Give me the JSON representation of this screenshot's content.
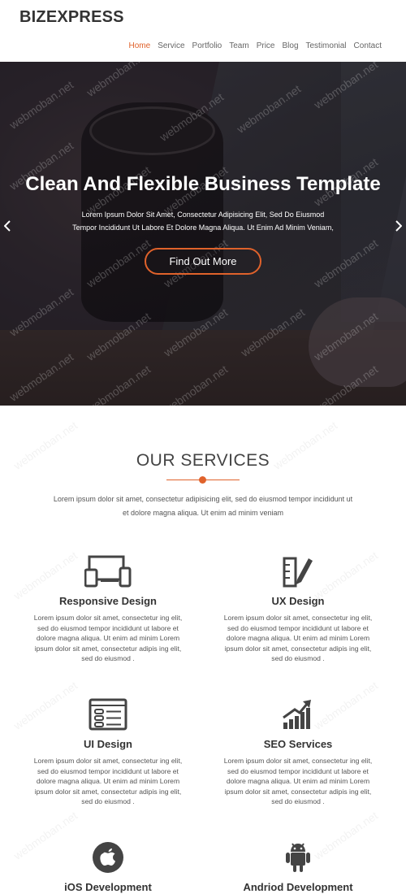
{
  "header": {
    "logo": "BIZEXPRESS",
    "nav": [
      "Home",
      "Service",
      "Portfolio",
      "Team",
      "Price",
      "Blog",
      "Testimonial",
      "Contact"
    ],
    "active_index": 0,
    "accent_color": "#e0622b"
  },
  "hero": {
    "title": "Clean And Flexible Business Template",
    "text_line1": "Lorem Ipsum Dolor Sit Amet, Consectetur Adipisicing Elit, Sed Do Eiusmod",
    "text_line2": "Tempor Incididunt Ut Labore Et Dolore Magna Aliqua. Ut Enim Ad Minim Veniam,",
    "button": "Find Out More",
    "prev_icon": "chevron-left-icon",
    "next_icon": "chevron-right-icon"
  },
  "watermark": "webmoban.net",
  "services": {
    "title": "OUR SERVICES",
    "intro_line1": "Lorem ipsum dolor sit amet, consectetur adipisicing elit, sed do eiusmod tempor incididunt ut",
    "intro_line2": "et dolore magna aliqua. Ut enim ad minim veniam",
    "items": [
      {
        "title": "Responsive Design",
        "icon": "devices-icon",
        "lines": [
          "Lorem ipsum dolor sit amet, consectetur ing elit,",
          "sed do eiusmod tempor incididunt ut labore et",
          "dolore magna aliqua. Ut enim ad minim Lorem",
          "ipsum dolor sit amet, consectetur adipis ing elit,",
          "sed do eiusmod ."
        ]
      },
      {
        "title": "UX Design",
        "icon": "pencil-ruler-icon",
        "lines": [
          "Lorem ipsum dolor sit amet, consectetur ing elit,",
          "sed do eiusmod tempor incididunt ut labore et",
          "dolore magna aliqua. Ut enim ad minim Lorem",
          "ipsum dolor sit amet, consectetur adipis ing elit,",
          "sed do eiusmod ."
        ]
      },
      {
        "title": "UI Design",
        "icon": "sliders-window-icon",
        "lines": [
          "Lorem ipsum dolor sit amet, consectetur ing elit,",
          "sed do eiusmod tempor incididunt ut labore et",
          "dolore magna aliqua. Ut enim ad minim Lorem",
          "ipsum dolor sit amet, consectetur adipis ing elit,",
          "sed do eiusmod ."
        ]
      },
      {
        "title": "SEO Services",
        "icon": "growth-chart-icon",
        "lines": [
          "Lorem ipsum dolor sit amet, consectetur ing elit,",
          "sed do eiusmod tempor incididunt ut labore et",
          "dolore magna aliqua. Ut enim ad minim Lorem",
          "ipsum dolor sit amet, consectetur adipis ing elit,",
          "sed do eiusmod ."
        ]
      },
      {
        "title": "iOS Development",
        "icon": "apple-icon",
        "lines": []
      },
      {
        "title": "Andriod Development",
        "icon": "android-icon",
        "lines": []
      }
    ]
  }
}
